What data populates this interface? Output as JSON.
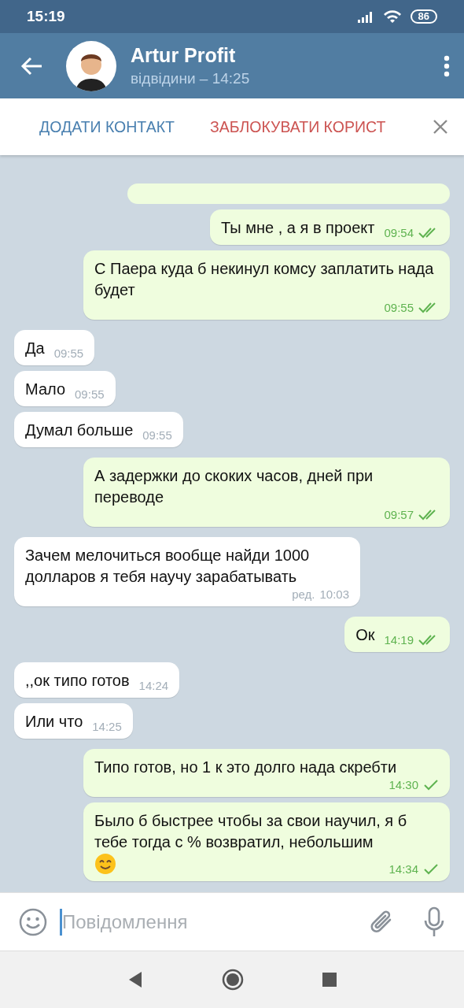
{
  "status_bar": {
    "time": "15:19",
    "battery": "86"
  },
  "header": {
    "name": "Artur Profit",
    "status": "відвідини – 14:25"
  },
  "action_bar": {
    "add_contact": "ДОДАТИ КОНТАКТ",
    "block_user": "ЗАБЛОКУВАТИ КОРИСТ"
  },
  "messages": [
    {
      "kind": "outgoing",
      "text": "Ты мне , а я в проект",
      "time": "09:54",
      "read": true
    },
    {
      "kind": "outgoing",
      "text": "С Паера куда б некинул комсу заплатить нада будет",
      "time": "09:55",
      "read": true
    },
    {
      "kind": "incoming",
      "text": "Да",
      "time": "09:55"
    },
    {
      "kind": "incoming",
      "text": "Мало",
      "time": "09:55"
    },
    {
      "kind": "incoming",
      "text": "Думал больше",
      "time": "09:55"
    },
    {
      "kind": "outgoing",
      "text": "А задержки до скоких часов, дней  при переводе",
      "time": "09:57",
      "read": true
    },
    {
      "kind": "incoming",
      "text": "Зачем мелочиться вообще найди 1000 долларов я тебя научу зарабатывать",
      "time": "10:03",
      "edited": "ред."
    },
    {
      "kind": "outgoing",
      "text": "Ок",
      "time": "14:19",
      "read": true
    },
    {
      "kind": "incoming",
      "text": ",,ок типо готов",
      "time": "14:24"
    },
    {
      "kind": "incoming",
      "text": "Или что",
      "time": "14:25"
    },
    {
      "kind": "outgoing",
      "text": "Типо готов, но 1 к это долго нада скребти",
      "time": "14:30",
      "read": false
    },
    {
      "kind": "outgoing",
      "text": "Было б быстрее чтобы за свои научил, я б тебе тогда с % возвратил, небольшим",
      "time": "14:34",
      "read": false,
      "trailing_emoji": true
    }
  ],
  "composer": {
    "placeholder": "Повідомлення"
  }
}
